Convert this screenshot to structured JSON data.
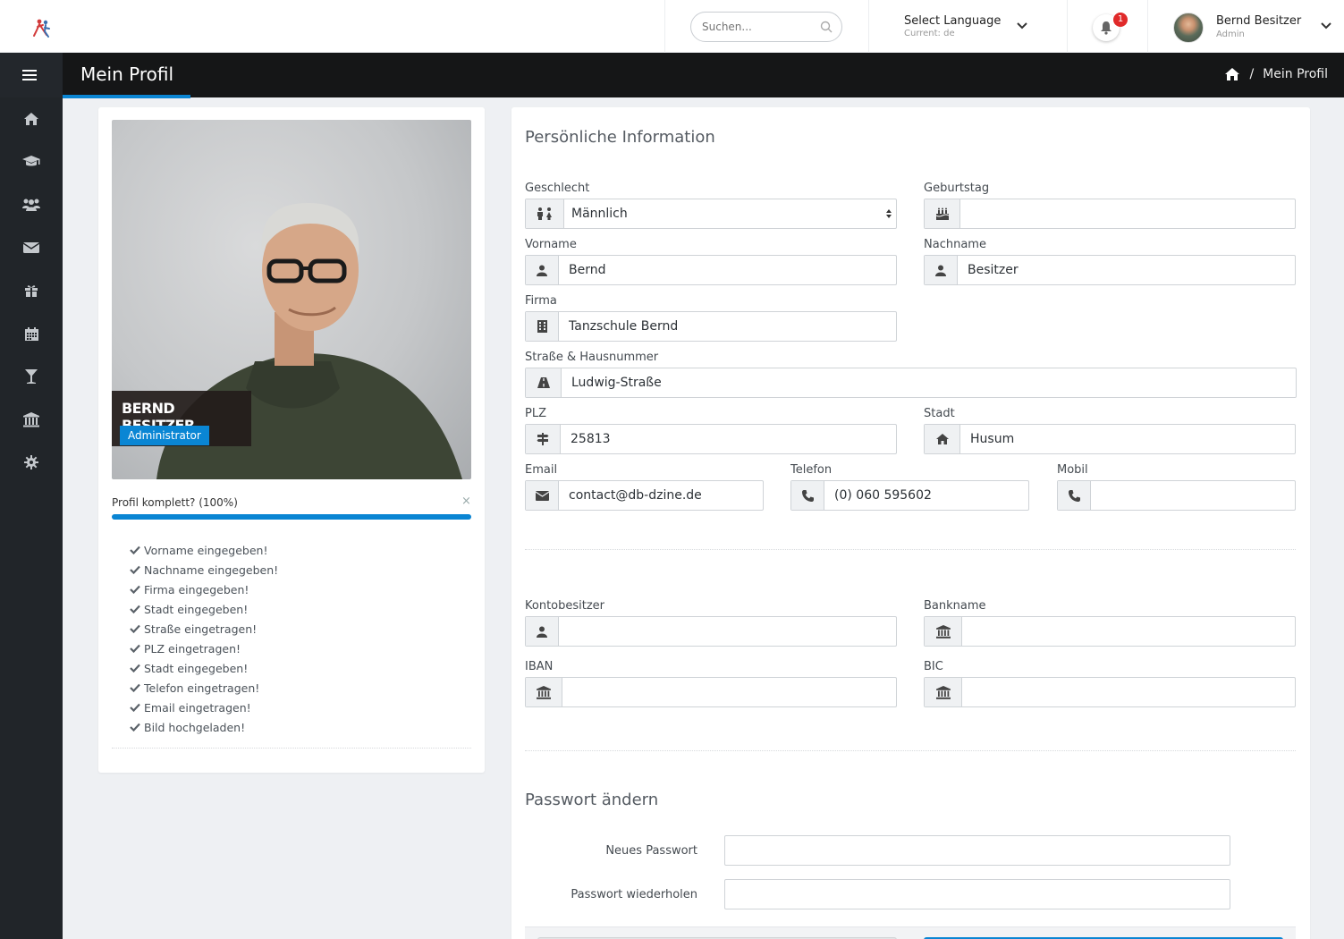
{
  "topbar": {
    "search_placeholder": "Suchen...",
    "language_title": "Select Language",
    "language_current": "Current: de",
    "notification_count": "1",
    "user_name": "Bernd Besitzer",
    "user_role": "Admin"
  },
  "header": {
    "title": "Mein Profil",
    "breadcrumb_current": "Mein Profil",
    "breadcrumb_separator": "/"
  },
  "sidebar": {
    "items": [
      "home-icon",
      "graduation-cap-icon",
      "users-icon",
      "envelope-icon",
      "gift-icon",
      "calendar-icon",
      "trophy-icon",
      "bank-icon",
      "gear-icon"
    ]
  },
  "profile_card": {
    "name": "BERND BESITZER",
    "role": "Administrator",
    "progress_label": "Profil komplett? (100%)",
    "progress_percent": 100,
    "close_symbol": "×",
    "checklist": [
      "Vorname eingegeben!",
      "Nachname eingegeben!",
      "Firma eingegeben!",
      "Stadt eingegeben!",
      "Straße eingetragen!",
      "PLZ eingetragen!",
      "Stadt eingegeben!",
      "Telefon eingetragen!",
      "Email eingetragen!",
      "Bild hochgeladen!"
    ]
  },
  "personal": {
    "title": "Persönliche Information",
    "gender_label": "Geschlecht",
    "gender_value": "Männlich",
    "birthday_label": "Geburtstag",
    "birthday_value": "",
    "firstname_label": "Vorname",
    "firstname_value": "Bernd",
    "lastname_label": "Nachname",
    "lastname_value": "Besitzer",
    "company_label": "Firma",
    "company_value": "Tanzschule Bernd",
    "street_label": "Straße & Hausnummer",
    "street_value": "Ludwig-Straße",
    "zip_label": "PLZ",
    "zip_value": "25813",
    "city_label": "Stadt",
    "city_value": "Husum",
    "email_label": "Email",
    "email_value": "contact@db-dzine.de",
    "phone_label": "Telefon",
    "phone_value": "(0) 060 595602",
    "mobile_label": "Mobil",
    "mobile_value": ""
  },
  "bank": {
    "owner_label": "Kontobesitzer",
    "owner_value": "",
    "bankname_label": "Bankname",
    "bankname_value": "",
    "iban_label": "IBAN",
    "iban_value": "",
    "bic_label": "BIC",
    "bic_value": ""
  },
  "password": {
    "title": "Passwort ändern",
    "new_label": "Neues Passwort",
    "repeat_label": "Passwort wiederholen"
  },
  "colors": {
    "accent": "#0a85d3",
    "sidebar": "#212529",
    "header": "#151617",
    "badge": "#e02a2a"
  }
}
